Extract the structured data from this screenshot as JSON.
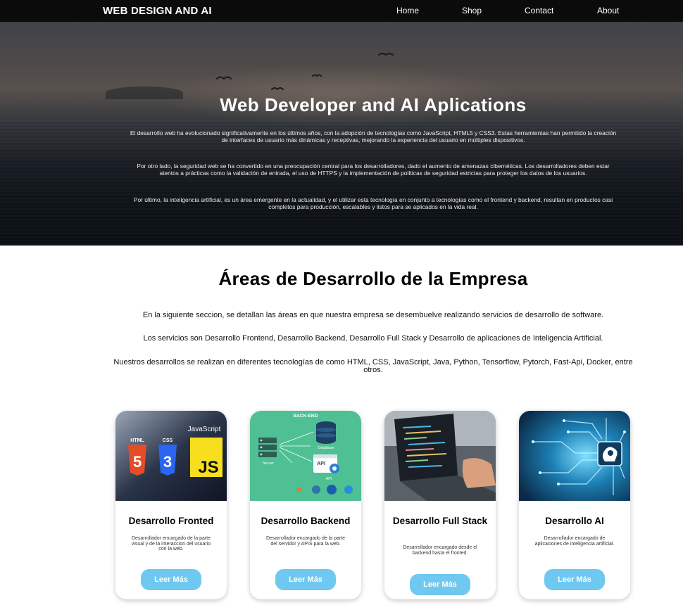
{
  "nav": {
    "brand": "WEB DESIGN AND AI",
    "links": [
      "Home",
      "Shop",
      "Contact",
      "About"
    ]
  },
  "hero": {
    "title": "Web Developer and AI Aplications",
    "paragraphs": [
      "El desarrollo web ha evolucionado significativamente en los últimos años, con la adopción de tecnologías como JavaScript, HTML5 y CSS3. Estas herramientas han permitido la creación de interfaces de usuario más dinámicas y receptivas, mejorando la experiencia del usuario en múltiples dispositivos.",
      "Por otro lado, la seguridad web se ha convertido en una preocupación central para los desarrolladores, dado el aumento de amenazas cibernéticas. Los desarrolladores deben estar atentos a prácticas como la validación de entrada, el uso de HTTPS y la implementación de políticas de seguridad estrictas para proteger los datos de los usuarios.",
      "Por último, la inteligencia artificial, es un área emergente en la actualidad, y el utilizar esta tecnología en conjunto a tecnologías como el frontend y backend, resultan en productos casi completos para producción, escalables y listos para se aplicados en la vida real."
    ]
  },
  "areas": {
    "title": "Áreas de Desarrollo de la Empresa",
    "paragraphs": [
      "En la siguiente seccion, se detallan las áreas en que nuestra empresa se desembuelve realizando servicios de desarrollo de software.",
      "Los servicios son Desarrollo Frontend, Desarrollo Backend, Desarrollo Full Stack y Desarrollo de aplicaciones de Inteligencia Artificial.",
      "Nuestros desarrollos se realizan en diferentes tecnologías de como HTML, CSS, JavaScript, Java, Python, Tensorflow, Pytorch, Fast-Api, Docker, entre otros."
    ]
  },
  "cards": [
    {
      "title": "Desarrollo Fronted",
      "description": "Desarrollador encargado de la parte visual y de la interaccion del usuario con la web.",
      "button": "Leer Más",
      "image": {
        "labels": [
          "JavaScript",
          "HTML",
          "CSS",
          "JS",
          "5",
          "3"
        ]
      }
    },
    {
      "title": "Desarrollo Backend",
      "description": "Desarrollador encargado de la parte del servidor y APIS para la web.",
      "button": "Leer Más",
      "image": {
        "labels": [
          "BACK-END",
          "Database",
          "Server",
          "API",
          "API"
        ]
      }
    },
    {
      "title": "Desarrollo Full Stack",
      "description": "Desarrollador encargado desde el backend hasta el fronted.",
      "button": "Leer Más",
      "image": {
        "labels": []
      }
    },
    {
      "title": "Desarrollo AI",
      "description": "Desarrollador encargado de aplicaciones de inteligencia artificial.",
      "button": "Leer Más",
      "image": {
        "labels": []
      }
    }
  ],
  "colors": {
    "nav_bg": "#0b0b0b",
    "button_bg": "#6ec8f0",
    "backend_img_bg": "#4fbf94"
  }
}
